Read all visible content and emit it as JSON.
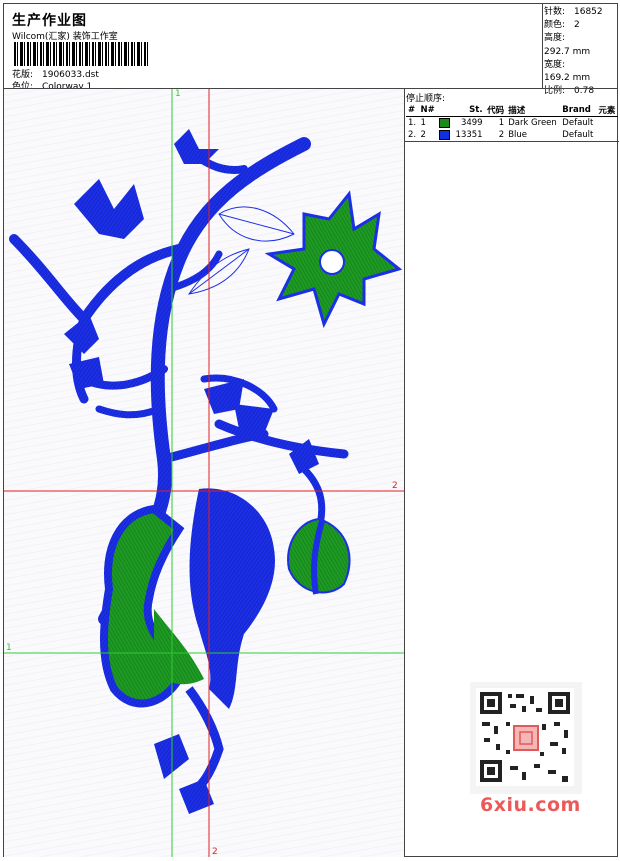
{
  "header": {
    "title": "生产作业图",
    "studio": "Wilcom(汇家) 装饰工作室",
    "design_label": "花版:",
    "design_value": "1906033.dst",
    "colorway_label": "色位:",
    "colorway_value": "Colorway 1"
  },
  "stats": [
    {
      "label": "针数:",
      "value": "16852"
    },
    {
      "label": "颜色:",
      "value": "2"
    },
    {
      "label": "高度:",
      "value": "292.7 mm"
    },
    {
      "label": "宽度:",
      "value": "169.2 mm"
    },
    {
      "label": "比例:",
      "value": "0.78"
    }
  ],
  "stop_sequence": {
    "title": "停止顺序:",
    "columns": [
      "#",
      "N#",
      "St.",
      "代码",
      "描述",
      "Brand",
      "元素"
    ],
    "rows": [
      {
        "num": "1.",
        "n": "1",
        "color": "#1a8a1a",
        "stitches": "3499",
        "code": "1",
        "desc": "Dark Green",
        "brand": "Default",
        "element": ""
      },
      {
        "num": "2.",
        "n": "2",
        "color": "#1030e0",
        "stitches": "13351",
        "code": "2",
        "desc": "Blue",
        "brand": "Default",
        "element": ""
      }
    ]
  },
  "guides": {
    "green_v_label": "1",
    "green_h_label": "1",
    "red_v_label": "2",
    "red_h_label": "2"
  },
  "colors": {
    "blue": "#1c2fe6",
    "green": "#1e9a24",
    "guide_green": "#2ecc2e",
    "guide_red": "#e02020"
  },
  "watermark": {
    "text": "6xiu.com"
  }
}
